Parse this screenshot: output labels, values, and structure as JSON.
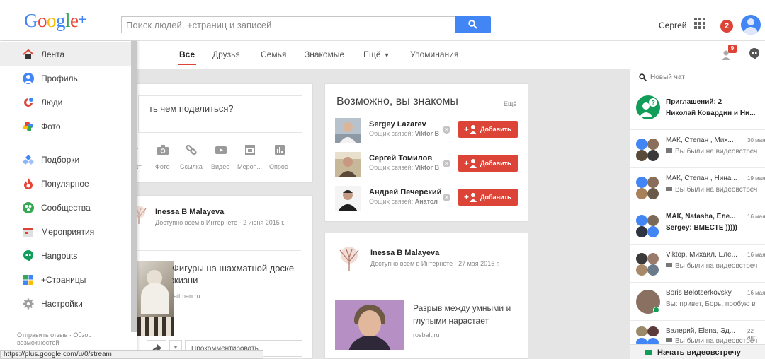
{
  "header": {
    "logo_text": "Google",
    "logo_plus": "+",
    "search_placeholder": "Поиск людей, +страниц и записей",
    "user_name": "Сергей",
    "notification_count": "2"
  },
  "nav": {
    "tabs": [
      {
        "label": "Все",
        "active": true
      },
      {
        "label": "Друзья"
      },
      {
        "label": "Семья"
      },
      {
        "label": "Знакомые"
      },
      {
        "label": "Ещё"
      },
      {
        "label": "Упоминания"
      }
    ],
    "people_badge": "9"
  },
  "sidebar": {
    "items": [
      {
        "label": "Лента",
        "icon": "home-icon"
      },
      {
        "label": "Профиль",
        "icon": "profile-icon"
      },
      {
        "label": "Люди",
        "icon": "people-icon"
      },
      {
        "label": "Фото",
        "icon": "photos-icon"
      },
      {
        "label": "Подборки",
        "icon": "collections-icon"
      },
      {
        "label": "Популярное",
        "icon": "fire-icon"
      },
      {
        "label": "Сообщества",
        "icon": "communities-icon"
      },
      {
        "label": "Мероприятия",
        "icon": "events-icon"
      },
      {
        "label": "Hangouts",
        "icon": "hangouts-icon"
      },
      {
        "label": "+Страницы",
        "icon": "pages-icon"
      },
      {
        "label": "Настройки",
        "icon": "gear-icon"
      }
    ],
    "footer_line1": "Отправить отзыв · Обзор",
    "footer_line2": "возможностей",
    "status_url": "https://plus.google.com/u/0/stream"
  },
  "share": {
    "prompt": "ть чем поделиться?",
    "actions": [
      "ст",
      "Фото",
      "Ссылка",
      "Видео",
      "Мероп...",
      "Опрос"
    ]
  },
  "post1": {
    "author": "Inessa B Malayeva",
    "meta": "Доступно всем в Интернете  -  2 июня 2015 г.",
    "link_title": "Фигуры на шахматной доске жизни",
    "link_domain": "laitman.ru",
    "comment_placeholder": "Прокомментировать"
  },
  "suggestions": {
    "title": "Возможно, вы знакомы",
    "more": "Ещё",
    "add_label": "Добавить",
    "people": [
      {
        "name": "Sergey Lazarev",
        "mutual_prefix": "Общих связей: ",
        "mutual_name": "Viktor B"
      },
      {
        "name": "Сергей Томилов",
        "mutual_prefix": "Общих связей: ",
        "mutual_name": "Viktor B"
      },
      {
        "name": "Андрей Печерский",
        "mutual_prefix": "Общих связей: ",
        "mutual_name": "Анатол"
      }
    ]
  },
  "post2": {
    "author": "Inessa B Malayeva",
    "meta": "Доступно всем в Интернете  -  27 мая 2015 г.",
    "link_title": "Разрыв между умными и глупыми нарастает",
    "link_domain": "rosbalt.ru"
  },
  "chat": {
    "search_label": "Новый чат",
    "rows": [
      {
        "name": "Приглашений: 2",
        "date": "",
        "message": "Николай Ковардин и Ни...",
        "bold": true
      },
      {
        "name": "МАК, Степан , Мих...",
        "date": "30 мая",
        "message": "Вы были на видеовстреч",
        "bold": false
      },
      {
        "name": "МАК, Степан , Нина...",
        "date": "19 мая",
        "message": "Вы были на видеовстреч",
        "bold": false
      },
      {
        "name": "МАК, Natasha, Еле...",
        "date": "16 мая",
        "message": "Sergey: ВМЕСТЕ )))))",
        "bold": true
      },
      {
        "name": "Viktop, Михаил, Еле...",
        "date": "16 мая",
        "message": "Вы были на видеовстреч",
        "bold": false
      },
      {
        "name": "Boris Belotserkovsky",
        "date": "16 мая",
        "message": "Вы: привет, Борь, пробую в",
        "bold": false
      },
      {
        "name": "Валерий, Elena, Эд...",
        "date": "22 апр.",
        "message": "Вы были на видеовстреч",
        "bold": false
      }
    ],
    "footer_label": "Начать видеовстречу"
  },
  "colors": {
    "brand_red": "#db4437",
    "brand_blue": "#4285f4",
    "green": "#0f9d58"
  }
}
